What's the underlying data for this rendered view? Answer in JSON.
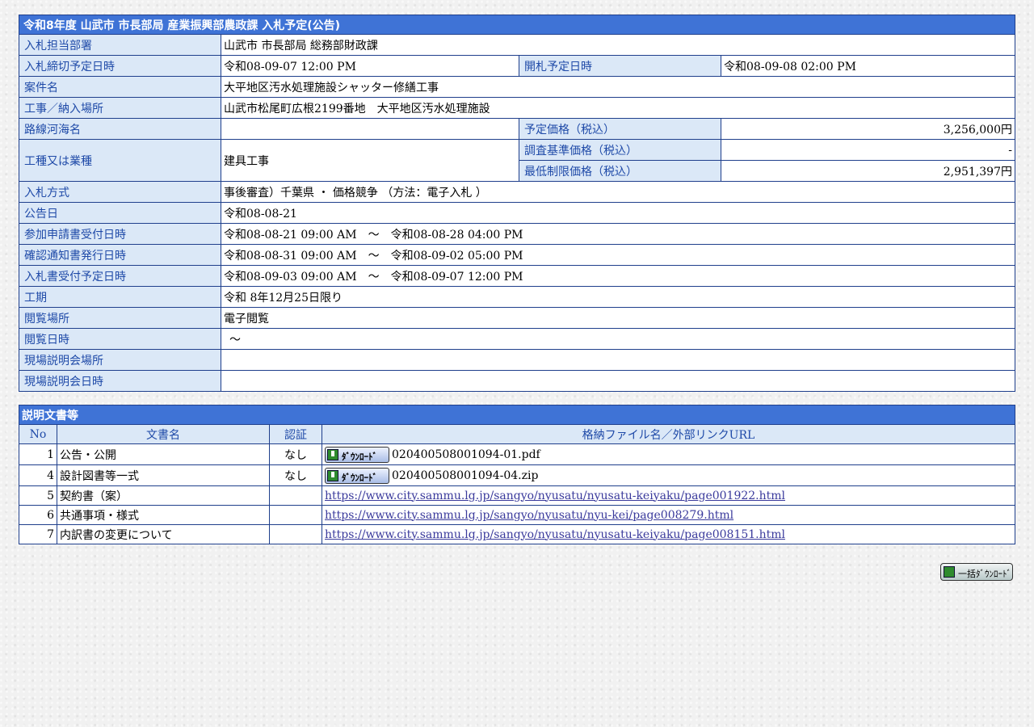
{
  "title": "令和8年度 山武市 市長部局 産業振興部農政課 入札予定(公告)",
  "rows": {
    "dept": {
      "label": "入札担当部署",
      "value": "山武市 市長部局 総務部財政課"
    },
    "deadline": {
      "label": "入札締切予定日時",
      "value": "令和08-09-07 12:00 PM",
      "label2": "開札予定日時",
      "value2": "令和08-09-08 02:00 PM"
    },
    "name": {
      "label": "案件名",
      "value": "大平地区汚水処理施設シャッター修繕工事"
    },
    "place": {
      "label": "工事／納入場所",
      "value": "山武市松尾町広根2199番地　大平地区汚水処理施設"
    },
    "route": {
      "label": "路線河海名",
      "value": "",
      "label2": "予定価格（税込）",
      "value2": "3,256,000円"
    },
    "type": {
      "label": "工種又は業種",
      "value": "建具工事",
      "label2a": "調査基準価格（税込）",
      "value2a": "-",
      "label2b": "最低制限価格（税込）",
      "value2b": "2,951,397円"
    },
    "method": {
      "label": "入札方式",
      "value": "事後審査）千葉県 ・ 価格競争 （方法：電子入札 ）"
    },
    "notice": {
      "label": "公告日",
      "value": "令和08-08-21"
    },
    "apply": {
      "label": "参加申請書受付日時",
      "value": "令和08-08-21 09:00 AM　～　令和08-08-28 04:00 PM"
    },
    "confirm": {
      "label": "確認通知書発行日時",
      "value": "令和08-08-31 09:00 AM　～　令和08-09-02 05:00 PM"
    },
    "bid": {
      "label": "入札書受付予定日時",
      "value": "令和08-09-03 09:00 AM　～　令和08-09-07 12:00 PM"
    },
    "period": {
      "label": "工期",
      "value": "令和 8年12月25日限り"
    },
    "viewplace": {
      "label": "閲覧場所",
      "value": "電子閲覧"
    },
    "viewdate": {
      "label": "閲覧日時",
      "value": "～"
    },
    "siteplace": {
      "label": "現場説明会場所",
      "value": ""
    },
    "sitedate": {
      "label": "現場説明会日時",
      "value": ""
    }
  },
  "docs": {
    "title": "説明文書等",
    "headers": [
      "No",
      "文書名",
      "認証",
      "格納ファイル名／外部リンクURL"
    ],
    "download_label": "ﾀﾞｳﾝﾛｰﾄﾞ",
    "items": [
      {
        "no": "1",
        "name": "公告・公開",
        "auth": "なし",
        "file": "020400508001094-01.pdf",
        "download": true
      },
      {
        "no": "4",
        "name": "設計図書等一式",
        "auth": "なし",
        "file": "020400508001094-04.zip",
        "download": true
      },
      {
        "no": "5",
        "name": "契約書（案）",
        "auth": "",
        "file": "https://www.city.sammu.lg.jp/sangyo/nyusatu/nyusatu-keiyaku/page001922.html",
        "download": false
      },
      {
        "no": "6",
        "name": "共通事項・様式",
        "auth": "",
        "file": "https://www.city.sammu.lg.jp/sangyo/nyusatu/nyu-kei/page008279.html",
        "download": false
      },
      {
        "no": "7",
        "name": "内訳書の変更について",
        "auth": "",
        "file": "https://www.city.sammu.lg.jp/sangyo/nyusatu/nyusatu-keiyaku/page008151.html",
        "download": false
      }
    ]
  },
  "bulk_download_label": "一括ﾀﾞｳﾝﾛｰﾄﾞ"
}
